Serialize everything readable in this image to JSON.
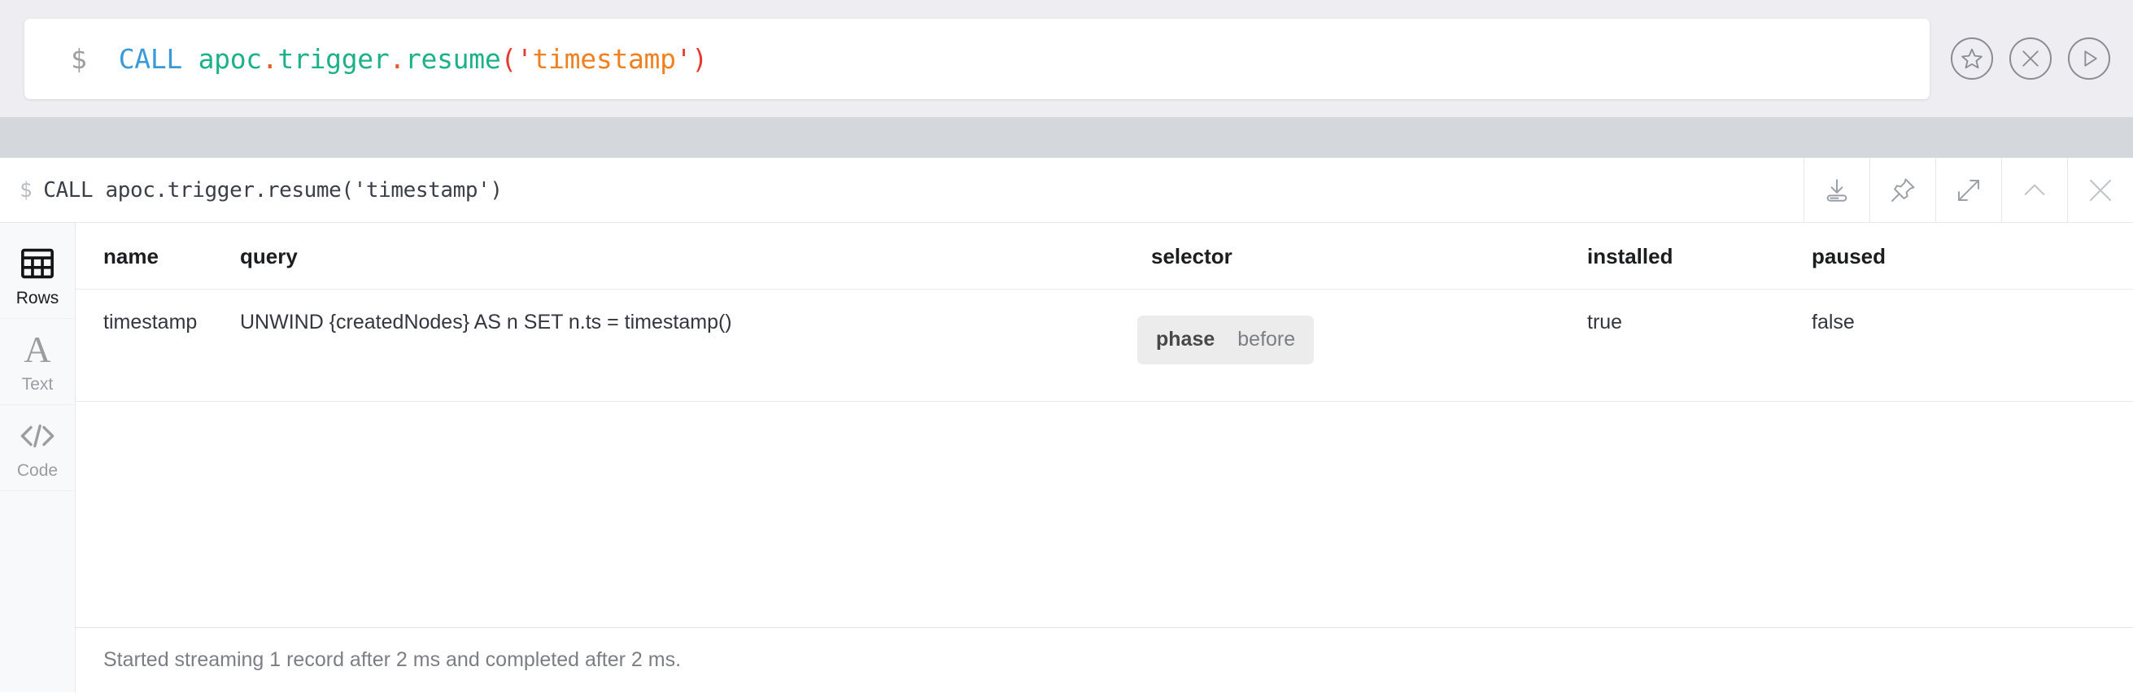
{
  "editor": {
    "prompt": "$",
    "tokens": [
      {
        "text": "CALL ",
        "kind": "keyword"
      },
      {
        "text": "apoc",
        "kind": "func"
      },
      {
        "text": ".",
        "kind": "dot"
      },
      {
        "text": "trigger",
        "kind": "func"
      },
      {
        "text": ".",
        "kind": "dot"
      },
      {
        "text": "resume",
        "kind": "func"
      },
      {
        "text": "(",
        "kind": "paren"
      },
      {
        "text": "'",
        "kind": "quote"
      },
      {
        "text": "timestamp",
        "kind": "string"
      },
      {
        "text": "'",
        "kind": "quote"
      },
      {
        "text": ")",
        "kind": "paren"
      }
    ],
    "plain_text": "CALL apoc.trigger.resume('timestamp')",
    "actions": [
      {
        "name": "favorite-button",
        "icon": "star-icon",
        "label": "Favorite"
      },
      {
        "name": "clear-button",
        "icon": "close-icon",
        "label": "Clear"
      },
      {
        "name": "run-button",
        "icon": "play-icon",
        "label": "Run"
      }
    ],
    "colors": {
      "background": "#eeeef2",
      "card": "#ffffff",
      "prompt": "#9e9e9e",
      "keyword": "#3a9ad9",
      "function": "#1cb188",
      "dot": "#e35b2d",
      "paren": "#e23c2e",
      "string": "#f08020",
      "icon_stroke": "#8a8d91"
    }
  },
  "gap": {
    "color": "#d4d7db"
  },
  "frame": {
    "prompt": "$",
    "query": "CALL apoc.trigger.resume('timestamp')",
    "tools": [
      {
        "name": "download-button",
        "icon": "download-icon",
        "label": "Download"
      },
      {
        "name": "pin-button",
        "icon": "pin-icon",
        "label": "Pin"
      },
      {
        "name": "expand-button",
        "icon": "expand-icon",
        "label": "Fullscreen"
      },
      {
        "name": "collapse-button",
        "icon": "chevron-up-icon",
        "label": "Collapse"
      },
      {
        "name": "close-frame-button",
        "icon": "close-icon",
        "label": "Close"
      }
    ]
  },
  "sidebar": {
    "items": [
      {
        "label": "Rows",
        "icon": "table-icon",
        "active": true
      },
      {
        "label": "Text",
        "icon": "text-a-icon",
        "active": false
      },
      {
        "label": "Code",
        "icon": "code-brackets-icon",
        "active": false
      }
    ]
  },
  "table": {
    "columns": [
      "name",
      "query",
      "selector",
      "installed",
      "paused"
    ],
    "rows": [
      {
        "name": "timestamp",
        "query": "UNWIND {createdNodes} AS n SET n.ts = timestamp()",
        "selector": {
          "key": "phase",
          "value": "before"
        },
        "installed": "true",
        "paused": "false"
      }
    ]
  },
  "status": {
    "text": "Started streaming 1 record after 2 ms and completed after 2 ms."
  }
}
